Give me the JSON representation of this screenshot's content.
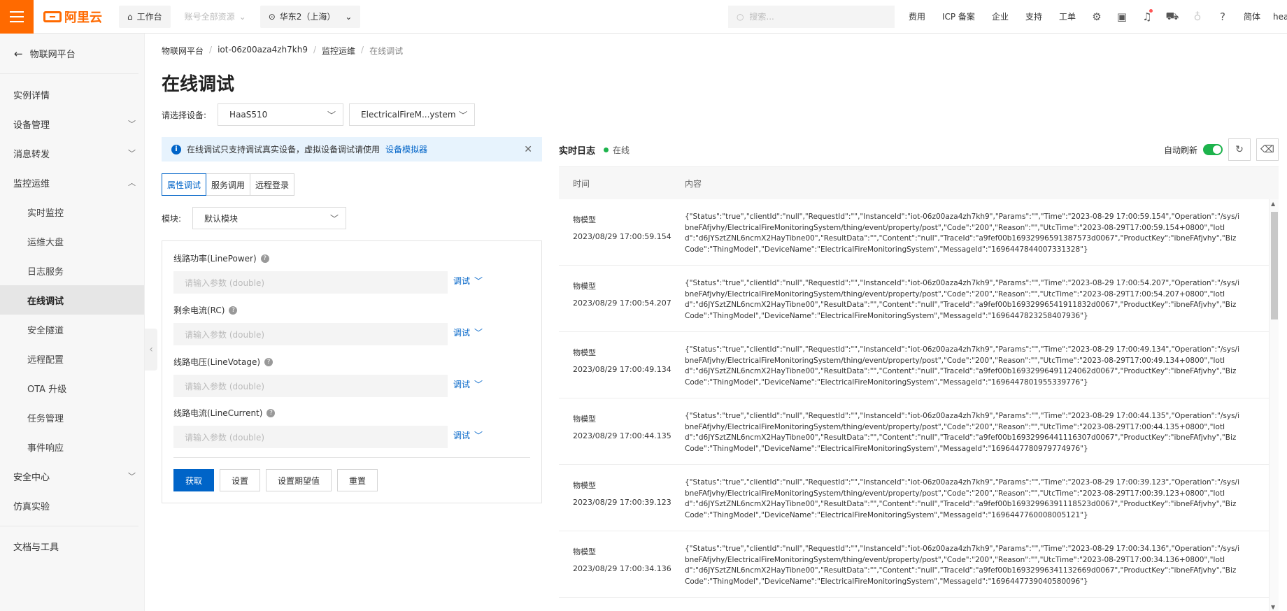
{
  "topbar": {
    "logo_text": "阿里云",
    "workbench": "工作台",
    "account_resources": "账号全部资源",
    "region": "华东2（上海）",
    "search_placeholder": "搜索...",
    "links": [
      "费用",
      "ICP 备案",
      "企业",
      "支持",
      "工单"
    ],
    "language": "简体",
    "user": "hea"
  },
  "sidebar": {
    "back_label": "物联网平台",
    "items": [
      {
        "label": "实例详情"
      },
      {
        "label": "设备管理"
      },
      {
        "label": "消息转发"
      },
      {
        "label": "监控运维"
      },
      {
        "label": "实时监控"
      },
      {
        "label": "运维大盘"
      },
      {
        "label": "日志服务"
      },
      {
        "label": "在线调试"
      },
      {
        "label": "安全隧道"
      },
      {
        "label": "远程配置"
      },
      {
        "label": "OTA 升级"
      },
      {
        "label": "任务管理"
      },
      {
        "label": "事件响应"
      },
      {
        "label": "安全中心"
      },
      {
        "label": "仿真实验"
      },
      {
        "label": "文档与工具"
      }
    ]
  },
  "breadcrumb": [
    "物联网平台",
    "iot-06z00aza4zh7kh9",
    "监控运维",
    "在线调试"
  ],
  "page_title": "在线调试",
  "device_select": {
    "label": "请选择设备:",
    "product": "HaaS510",
    "device": "ElectricalFireM...ystem"
  },
  "alert": {
    "text": "在线调试只支持调试真实设备，虚拟设备调试请使用",
    "link": "设备模拟器"
  },
  "tabs": [
    "属性调试",
    "服务调用",
    "远程登录"
  ],
  "module": {
    "label": "模块:",
    "value": "默认模块"
  },
  "fields": [
    {
      "label": "线路功率(LinePower)",
      "placeholder": "请输入参数 (double)",
      "action": "调试"
    },
    {
      "label": "剩余电流(RC)",
      "placeholder": "请输入参数 (double)",
      "action": "调试"
    },
    {
      "label": "线路电压(LineVotage)",
      "placeholder": "请输入参数 (double)",
      "action": "调试"
    },
    {
      "label": "线路电流(LineCurrent)",
      "placeholder": "请输入参数 (double)",
      "action": "调试"
    }
  ],
  "buttons": {
    "get": "获取",
    "set": "设置",
    "set_expected": "设置期望值",
    "reset": "重置"
  },
  "log": {
    "title": "实时日志",
    "status": "在线",
    "auto_refresh": "自动刷新",
    "auto_refresh_on": true,
    "col_time": "时间",
    "col_content": "内容",
    "rows": [
      {
        "type": "物模型",
        "time": "2023/08/29 17:00:59.154",
        "content": "{\"Status\":\"true\",\"clientId\":\"null\",\"RequestId\":\"\",\"InstanceId\":\"iot-06z00aza4zh7kh9\",\"Params\":\"\",\"Time\":\"2023-08-29 17:00:59.154\",\"Operation\":\"/sys/ibneFAfjvhy/ElectricalFireMonitoringSystem/thing/event/property/post\",\"Code\":\"200\",\"Reason\":\"\",\"UtcTime\":\"2023-08-29T17:00:59.154+0800\",\"IotId\":\"d6JYSztZNL6ncmX2HayTibne00\",\"ResultData\":\"\",\"Content\":\"null\",\"TraceId\":\"a9fef00b16932996591387573d0067\",\"ProductKey\":\"ibneFAfjvhy\",\"BizCode\":\"ThingModel\",\"DeviceName\":\"ElectricalFireMonitoringSystem\",\"MessageId\":\"1696447844007331328\"}"
      },
      {
        "type": "物模型",
        "time": "2023/08/29 17:00:54.207",
        "content": "{\"Status\":\"true\",\"clientId\":\"null\",\"RequestId\":\"\",\"InstanceId\":\"iot-06z00aza4zh7kh9\",\"Params\":\"\",\"Time\":\"2023-08-29 17:00:54.207\",\"Operation\":\"/sys/ibneFAfjvhy/ElectricalFireMonitoringSystem/thing/event/property/post\",\"Code\":\"200\",\"Reason\":\"\",\"UtcTime\":\"2023-08-29T17:00:54.207+0800\",\"IotId\":\"d6JYSztZNL6ncmX2HayTibne00\",\"ResultData\":\"\",\"Content\":\"null\",\"TraceId\":\"a9fef00b16932996541911832d0067\",\"ProductKey\":\"ibneFAfjvhy\",\"BizCode\":\"ThingModel\",\"DeviceName\":\"ElectricalFireMonitoringSystem\",\"MessageId\":\"1696447823258407936\"}"
      },
      {
        "type": "物模型",
        "time": "2023/08/29 17:00:49.134",
        "content": "{\"Status\":\"true\",\"clientId\":\"null\",\"RequestId\":\"\",\"InstanceId\":\"iot-06z00aza4zh7kh9\",\"Params\":\"\",\"Time\":\"2023-08-29 17:00:49.134\",\"Operation\":\"/sys/ibneFAfjvhy/ElectricalFireMonitoringSystem/thing/event/property/post\",\"Code\":\"200\",\"Reason\":\"\",\"UtcTime\":\"2023-08-29T17:00:49.134+0800\",\"IotId\":\"d6JYSztZNL6ncmX2HayTibne00\",\"ResultData\":\"\",\"Content\":\"null\",\"TraceId\":\"a9fef00b16932996491124062d0067\",\"ProductKey\":\"ibneFAfjvhy\",\"BizCode\":\"ThingModel\",\"DeviceName\":\"ElectricalFireMonitoringSystem\",\"MessageId\":\"1696447801955339776\"}"
      },
      {
        "type": "物模型",
        "time": "2023/08/29 17:00:44.135",
        "content": "{\"Status\":\"true\",\"clientId\":\"null\",\"RequestId\":\"\",\"InstanceId\":\"iot-06z00aza4zh7kh9\",\"Params\":\"\",\"Time\":\"2023-08-29 17:00:44.135\",\"Operation\":\"/sys/ibneFAfjvhy/ElectricalFireMonitoringSystem/thing/event/property/post\",\"Code\":\"200\",\"Reason\":\"\",\"UtcTime\":\"2023-08-29T17:00:44.135+0800\",\"IotId\":\"d6JYSztZNL6ncmX2HayTibne00\",\"ResultData\":\"\",\"Content\":\"null\",\"TraceId\":\"a9fef00b16932996441116307d0067\",\"ProductKey\":\"ibneFAfjvhy\",\"BizCode\":\"ThingModel\",\"DeviceName\":\"ElectricalFireMonitoringSystem\",\"MessageId\":\"1696447780979774976\"}"
      },
      {
        "type": "物模型",
        "time": "2023/08/29 17:00:39.123",
        "content": "{\"Status\":\"true\",\"clientId\":\"null\",\"RequestId\":\"\",\"InstanceId\":\"iot-06z00aza4zh7kh9\",\"Params\":\"\",\"Time\":\"2023-08-29 17:00:39.123\",\"Operation\":\"/sys/ibneFAfjvhy/ElectricalFireMonitoringSystem/thing/event/property/post\",\"Code\":\"200\",\"Reason\":\"\",\"UtcTime\":\"2023-08-29T17:00:39.123+0800\",\"IotId\":\"d6JYSztZNL6ncmX2HayTibne00\",\"ResultData\":\"\",\"Content\":\"null\",\"TraceId\":\"a9fef00b16932996391118523d0067\",\"ProductKey\":\"ibneFAfjvhy\",\"BizCode\":\"ThingModel\",\"DeviceName\":\"ElectricalFireMonitoringSystem\",\"MessageId\":\"1696447760008005121\"}"
      },
      {
        "type": "物模型",
        "time": "2023/08/29 17:00:34.136",
        "content": "{\"Status\":\"true\",\"clientId\":\"null\",\"RequestId\":\"\",\"InstanceId\":\"iot-06z00aza4zh7kh9\",\"Params\":\"\",\"Time\":\"2023-08-29 17:00:34.136\",\"Operation\":\"/sys/ibneFAfjvhy/ElectricalFireMonitoringSystem/thing/event/property/post\",\"Code\":\"200\",\"Reason\":\"\",\"UtcTime\":\"2023-08-29T17:00:34.136+0800\",\"IotId\":\"d6JYSztZNL6ncmX2HayTibne00\",\"ResultData\":\"\",\"Content\":\"null\",\"TraceId\":\"a9fef00b16932996341132669d0067\",\"ProductKey\":\"ibneFAfjvhy\",\"BizCode\":\"ThingModel\",\"DeviceName\":\"ElectricalFireMonitoringSystem\",\"MessageId\":\"1696447739040580096\"}"
      }
    ]
  },
  "colors": {
    "brand": "#ff6a00",
    "primary": "#0064c8",
    "online": "#1db34c"
  }
}
